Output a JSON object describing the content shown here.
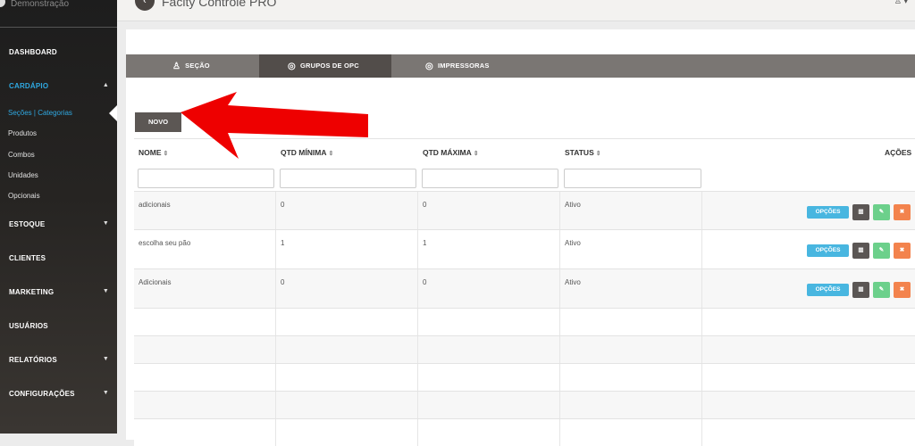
{
  "sidebar": {
    "org": "Demonstração",
    "items": [
      {
        "label": "DASHBOARD"
      },
      {
        "label": "CARDÁPIO"
      },
      {
        "label": "ESTOQUE"
      },
      {
        "label": "CLIENTES"
      },
      {
        "label": "MARKETING"
      },
      {
        "label": "USUÁRIOS"
      },
      {
        "label": "RELATÓRIOS"
      },
      {
        "label": "CONFIGURAÇÕES"
      }
    ],
    "cardapio_sub": [
      {
        "label": "Seções | Categorias"
      },
      {
        "label": "Produtos"
      },
      {
        "label": "Combos"
      },
      {
        "label": "Unidades"
      },
      {
        "label": "Opcionais"
      }
    ]
  },
  "topbar": {
    "title": "Facity Controle PRO"
  },
  "tabs": [
    {
      "label": "SEÇÃO",
      "icon": "user-icon"
    },
    {
      "label": "GRUPOS DE OPC",
      "icon": "dribbble-icon"
    },
    {
      "label": "IMPRESSORAS",
      "icon": "dribbble-icon"
    }
  ],
  "toolbar": {
    "novo_label": "NOVO"
  },
  "table": {
    "headers": [
      "NOME",
      "QTD MÍNIMA",
      "QTD MÁXIMA",
      "STATUS",
      "AÇÕES"
    ],
    "rows": [
      {
        "nome": "adicionais",
        "min": "0",
        "max": "0",
        "status": "Ativo"
      },
      {
        "nome": "escolha seu pão",
        "min": "1",
        "max": "1",
        "status": "Ativo"
      },
      {
        "nome": "Adicionais",
        "min": "0",
        "max": "0",
        "status": "Ativo"
      }
    ],
    "opcoes_label": "OPÇÕES"
  },
  "colors": {
    "accent": "#2fa8e1",
    "arrow": "#ee0000",
    "edit": "#6cd08b",
    "delete": "#f3834d"
  }
}
